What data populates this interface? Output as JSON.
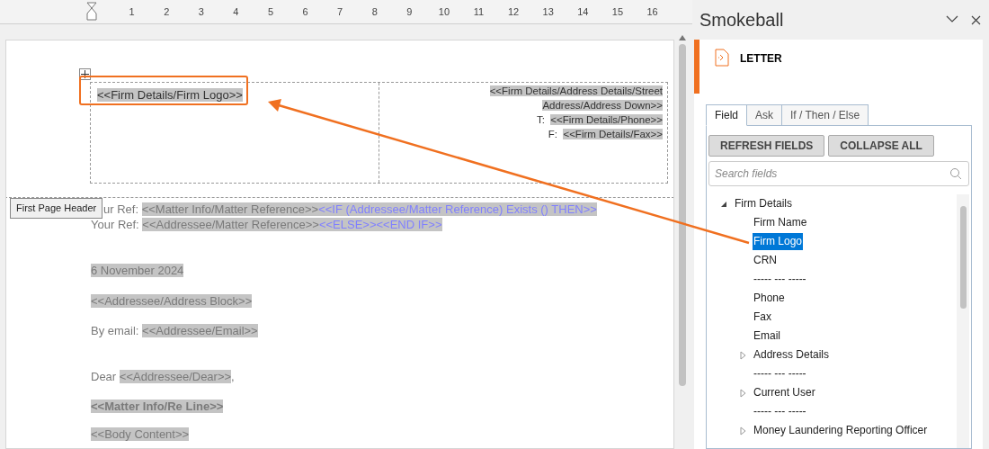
{
  "ruler": {
    "labels": [
      "1",
      "2",
      "3",
      "4",
      "5",
      "6",
      "7",
      "8",
      "9",
      "10",
      "11",
      "12",
      "13",
      "14",
      "15",
      "16"
    ]
  },
  "document": {
    "header": {
      "logo_field": "<<Firm Details/Firm Logo>>",
      "highlighted": true,
      "address_lines": [
        [
          {
            "kind": "field",
            "text": "<<Firm Details/Address Details/Street"
          }
        ],
        [
          {
            "kind": "field",
            "text": "Address/Address Down>>"
          }
        ],
        [
          {
            "kind": "plain",
            "text": "T:  "
          },
          {
            "kind": "field",
            "text": "<<Firm Details/Phone>>"
          }
        ],
        [
          {
            "kind": "plain",
            "text": "F:  "
          },
          {
            "kind": "field",
            "text": "<<Firm Details/Fax>>"
          }
        ]
      ],
      "tag": "First Page Header"
    },
    "body": [
      {
        "bold": false,
        "parts": [
          {
            "kind": "plain",
            "text": "ur Ref: "
          },
          {
            "kind": "field",
            "text": "<<Matter Info/Matter Reference>>"
          },
          {
            "kind": "cond",
            "text": "<<IF (Addressee/Matter Reference) Exists () THEN>>"
          }
        ]
      },
      {
        "bold": false,
        "parts": [
          {
            "kind": "plain",
            "text": "Your Ref: "
          },
          {
            "kind": "field",
            "text": "<<Addressee/Matter Reference>>"
          },
          {
            "kind": "cond",
            "text": "<<ELSE>><<END IF>>"
          }
        ]
      },
      {
        "bold": false,
        "parts": [
          {
            "kind": "field",
            "text": "6 November 2024"
          }
        ]
      },
      {
        "bold": false,
        "parts": [
          {
            "kind": "field",
            "text": "<<Addressee/Address Block>>"
          }
        ]
      },
      {
        "bold": false,
        "parts": [
          {
            "kind": "plain",
            "text": "By email: "
          },
          {
            "kind": "field",
            "text": "<<Addressee/Email>>"
          }
        ]
      },
      {
        "bold": false,
        "parts": [
          {
            "kind": "plain",
            "text": "Dear "
          },
          {
            "kind": "field",
            "text": "<<Addressee/Dear>>"
          },
          {
            "kind": "plain",
            "text": ","
          }
        ]
      },
      {
        "bold": true,
        "parts": [
          {
            "kind": "field",
            "text": "<<Matter Info/Re Line>>"
          }
        ]
      },
      {
        "bold": false,
        "parts": [
          {
            "kind": "field",
            "text": "<<Body Content>>"
          }
        ]
      }
    ]
  },
  "panel": {
    "title": "Smokeball",
    "document_type": "LETTER",
    "tabs": [
      {
        "label": "Field",
        "selected": true
      },
      {
        "label": "Ask",
        "selected": false
      },
      {
        "label": "If / Then / Else",
        "selected": false
      }
    ],
    "buttons": [
      "REFRESH FIELDS",
      "COLLAPSE ALL"
    ],
    "search": {
      "placeholder": "Search fields"
    },
    "tree": [
      {
        "label": "Firm Details",
        "expanded": true,
        "selected": false,
        "children": [
          {
            "label": "Firm Name",
            "selected": false
          },
          {
            "label": "Firm Logo",
            "selected": true
          },
          {
            "label": "CRN",
            "selected": false
          },
          {
            "label": "----- --- -----",
            "selected": false
          },
          {
            "label": "Phone",
            "selected": false
          },
          {
            "label": "Fax",
            "selected": false
          },
          {
            "label": "Email",
            "selected": false
          },
          {
            "label": "Address Details",
            "expanded": false,
            "selected": false
          },
          {
            "label": "----- --- -----",
            "selected": false
          },
          {
            "label": "Current User",
            "expanded": false,
            "selected": false
          },
          {
            "label": "----- --- -----",
            "selected": false
          },
          {
            "label": "Money Laundering Reporting Officer",
            "expanded": false,
            "selected": false
          }
        ]
      }
    ]
  }
}
